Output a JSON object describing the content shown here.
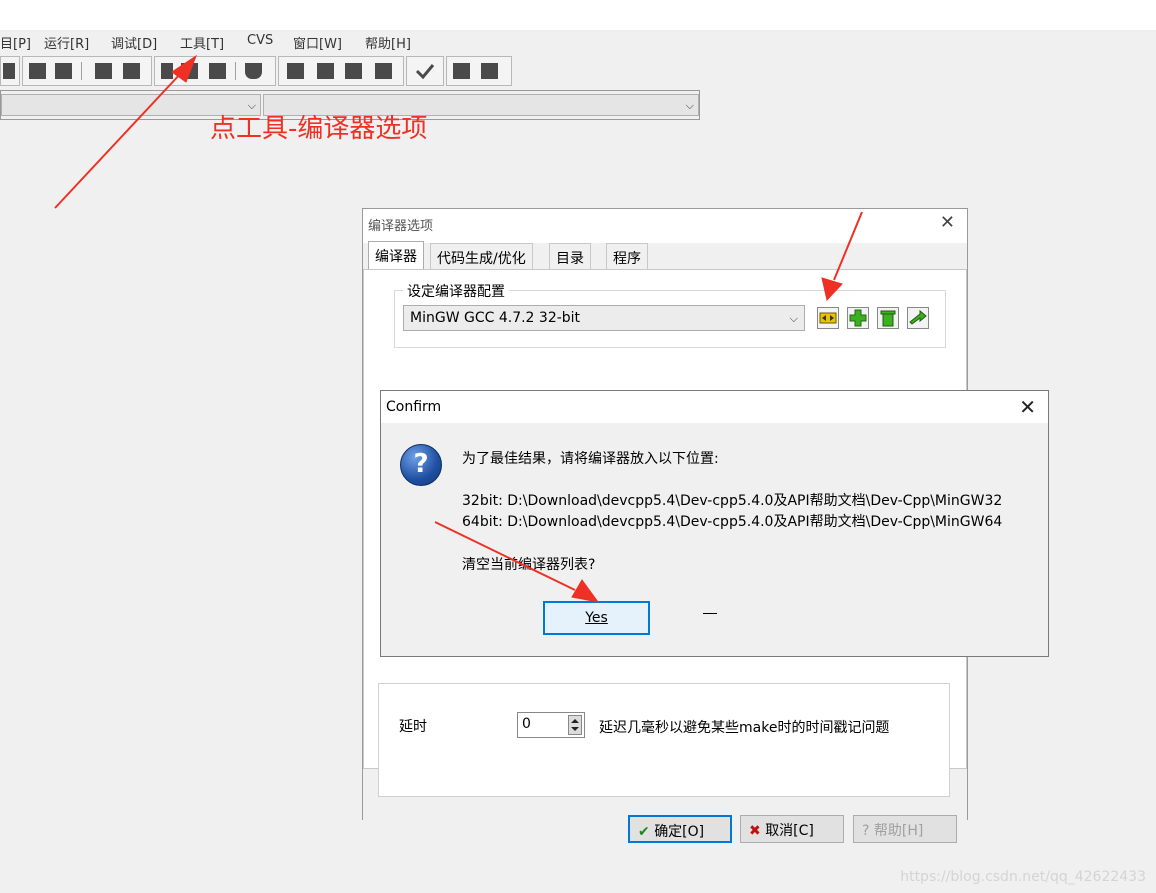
{
  "menubar": {
    "items": [
      "目[P]",
      "运行[R]",
      "调试[D]",
      "工具[T]",
      "CVS",
      "窗口[W]",
      "帮助[H]"
    ]
  },
  "annotation": "点工具-编译器选项",
  "compiler_options_dialog": {
    "title": "编译器选项",
    "close_glyph": "✕",
    "tabs": [
      "编译器",
      "代码生成/优化",
      "目录",
      "程序"
    ],
    "group_title": "设定编译器配置",
    "config_value": "MinGW GCC 4.7.2 32-bit",
    "delay_label": "延时",
    "delay_value": "0",
    "delay_description": "延迟几毫秒以避免某些make时的时间戳记问题",
    "buttons": {
      "ok": "确定[O]",
      "cancel": "取消[C]",
      "help": "帮助[H]"
    },
    "icons": [
      "find-compilers-icon",
      "add-compiler-icon",
      "delete-compiler-icon",
      "rename-compiler-icon"
    ]
  },
  "confirm_dialog": {
    "title": "Confirm",
    "close_glyph": "✕",
    "message_line1": "为了最佳结果，请将编译器放入以下位置:",
    "path_32": "32bit: D:\\Download\\devcpp5.4\\Dev-cpp5.4.0及API帮助文档\\Dev-Cpp\\MinGW32",
    "path_64": "64bit: D:\\Download\\devcpp5.4\\Dev-cpp5.4.0及API帮助文档\\Dev-Cpp\\MinGW64",
    "question": "清空当前编译器列表?",
    "yes_label": "Yes",
    "icon": "question-icon"
  },
  "watermark": "https://blog.csdn.net/qq_42622433",
  "colors": {
    "annotation_red": "#ee3124",
    "focus_blue": "#0078d7"
  }
}
